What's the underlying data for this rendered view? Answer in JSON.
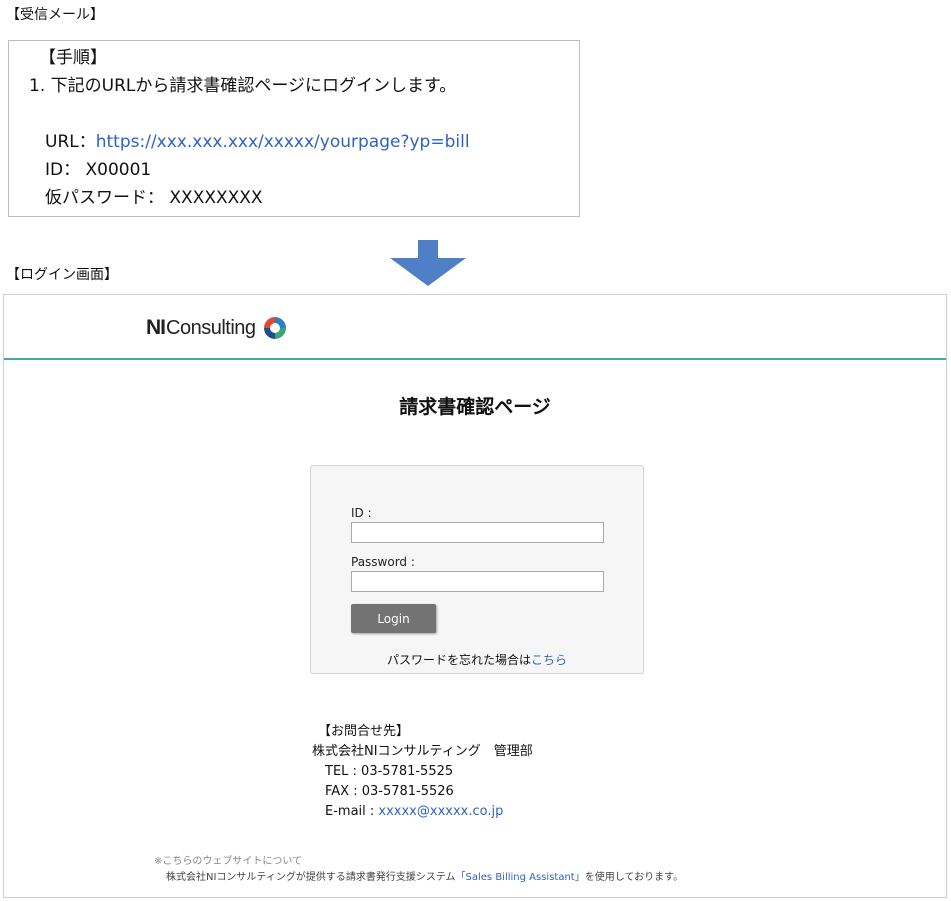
{
  "mail": {
    "caption": "【受信メール】",
    "steps_heading": "【手順】",
    "step1": "1. 下記のURLから請求書確認ページにログインします。",
    "url_label": "URL：",
    "url_value": "https://xxx.xxx.xxx/xxxxx/yourpage?yp=bill",
    "id_label": "ID：",
    "id_value": "X00001",
    "temp_password_label": "仮パスワード：",
    "temp_password_value": "XXXXXXXX"
  },
  "login_caption": "【ログイン画面】",
  "colors": {
    "arrow": "#4f7fc6",
    "header_rule": "#3fab98",
    "link": "#2f62c4",
    "login_button": "#737373"
  },
  "login_screen": {
    "logo_ni": "NI",
    "logo_consulting": "Consulting",
    "page_title": "請求書確認ページ",
    "form": {
      "id_label": "ID :",
      "id_value": "",
      "password_label": "Password :",
      "password_value": "",
      "login_label": "Login",
      "forgot_text": "パスワードを忘れた場合は",
      "forgot_link": "こちら"
    },
    "contact": {
      "heading": "【お問合せ先】",
      "company": "株式会社NIコンサルティング　管理部",
      "tel": "TEL : 03-5781-5525",
      "fax": "FAX : 03-5781-5526",
      "email_label": "E-mail : ",
      "email_value": "xxxxx@xxxxx.co.jp"
    },
    "footnote": {
      "line1": "※こちらのウェブサイトについて",
      "line2_prefix": "株式会社NIコンサルティングが提供する請求書発行支援システム",
      "line2_link": "「Sales Billing Assistant」",
      "line2_suffix": "を使用しております。"
    }
  }
}
